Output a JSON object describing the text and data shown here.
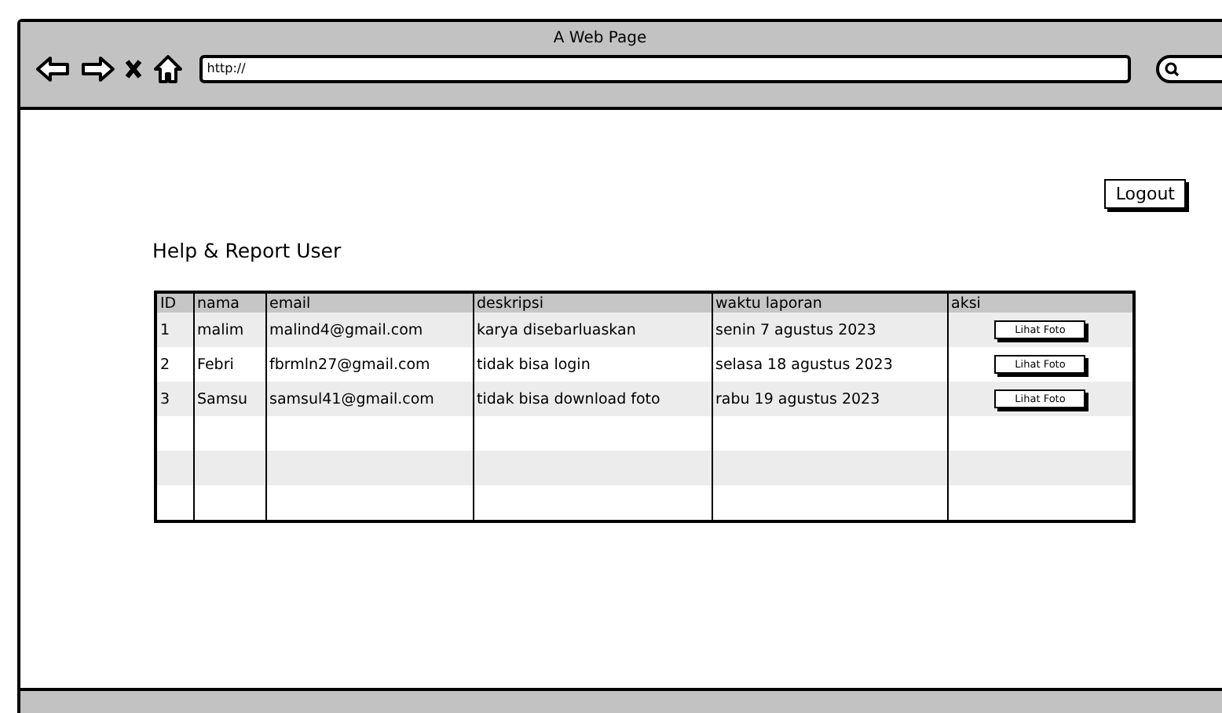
{
  "window": {
    "title": "A Web Page"
  },
  "address_bar": {
    "value": "http://"
  },
  "logout_button": "Logout",
  "page_title": "Help & Report User",
  "table": {
    "columns": [
      "ID",
      "nama",
      "email",
      "deskripsi",
      "waktu laporan",
      "aksi"
    ],
    "rows": [
      {
        "id": "1",
        "nama": "malim",
        "email": "malind4@gmail.com",
        "deskripsi": "karya disebarluaskan",
        "waktu": "senin 7 agustus 2023",
        "action": "Lihat Foto"
      },
      {
        "id": "2",
        "nama": "Febri",
        "email": "fbrmln27@gmail.com",
        "deskripsi": "tidak bisa login",
        "waktu": "selasa 18 agustus 2023",
        "action": "Lihat Foto"
      },
      {
        "id": "3",
        "nama": "Samsu",
        "email": "samsul41@gmail.com",
        "deskripsi": "tidak bisa download foto",
        "waktu": "rabu 19 agustus 2023",
        "action": "Lihat Foto"
      }
    ]
  }
}
